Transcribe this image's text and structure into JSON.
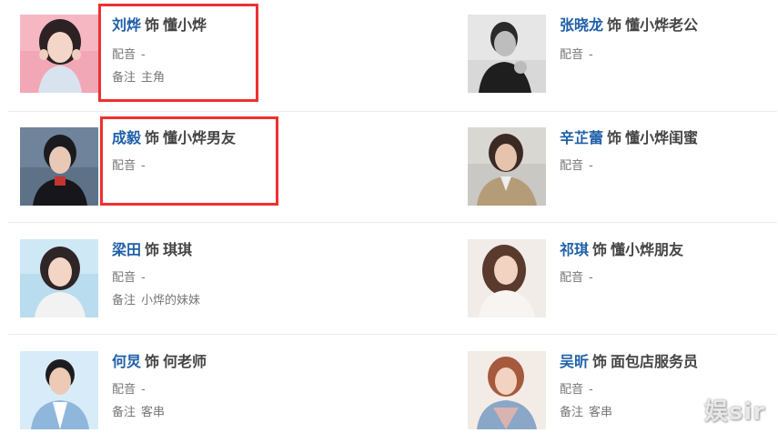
{
  "as_word": "饰",
  "labels": {
    "dub": "配音",
    "note": "备注"
  },
  "cast": [
    {
      "actor": "刘烨",
      "role": "懂小烨",
      "dub": "-",
      "note": "主角",
      "photo": "actress-portrait-pink",
      "highlighted": true
    },
    {
      "actor": "张晓龙",
      "role": "懂小烨老公",
      "dub": "-",
      "photo": "actor-portrait-bw"
    },
    {
      "actor": "成毅",
      "role": "懂小烨男友",
      "dub": "-",
      "photo": "actor-portrait-dark",
      "highlighted": true
    },
    {
      "actor": "辛芷蕾",
      "role": "懂小烨闺蜜",
      "dub": "-",
      "photo": "actress-portrait-trench"
    },
    {
      "actor": "梁田",
      "role": "琪琪",
      "dub": "-",
      "note": "小烨的妹妹",
      "photo": "actress-portrait-blue"
    },
    {
      "actor": "祁琪",
      "role": "懂小烨朋友",
      "dub": "-",
      "photo": "actress-portrait-white"
    },
    {
      "actor": "何炅",
      "role": "何老师",
      "dub": "-",
      "note": "客串",
      "photo": "actor-portrait-blue-shirt"
    },
    {
      "actor": "吴昕",
      "role": "面包店服务员",
      "dub": "-",
      "note": "客串",
      "photo": "actress-portrait-denim"
    }
  ],
  "watermark": "娱sir",
  "colors": {
    "actor_link": "#1f5fa8",
    "text": "#444444",
    "meta": "#777777",
    "highlight": "#ef3030",
    "divider": "#ebebeb"
  }
}
